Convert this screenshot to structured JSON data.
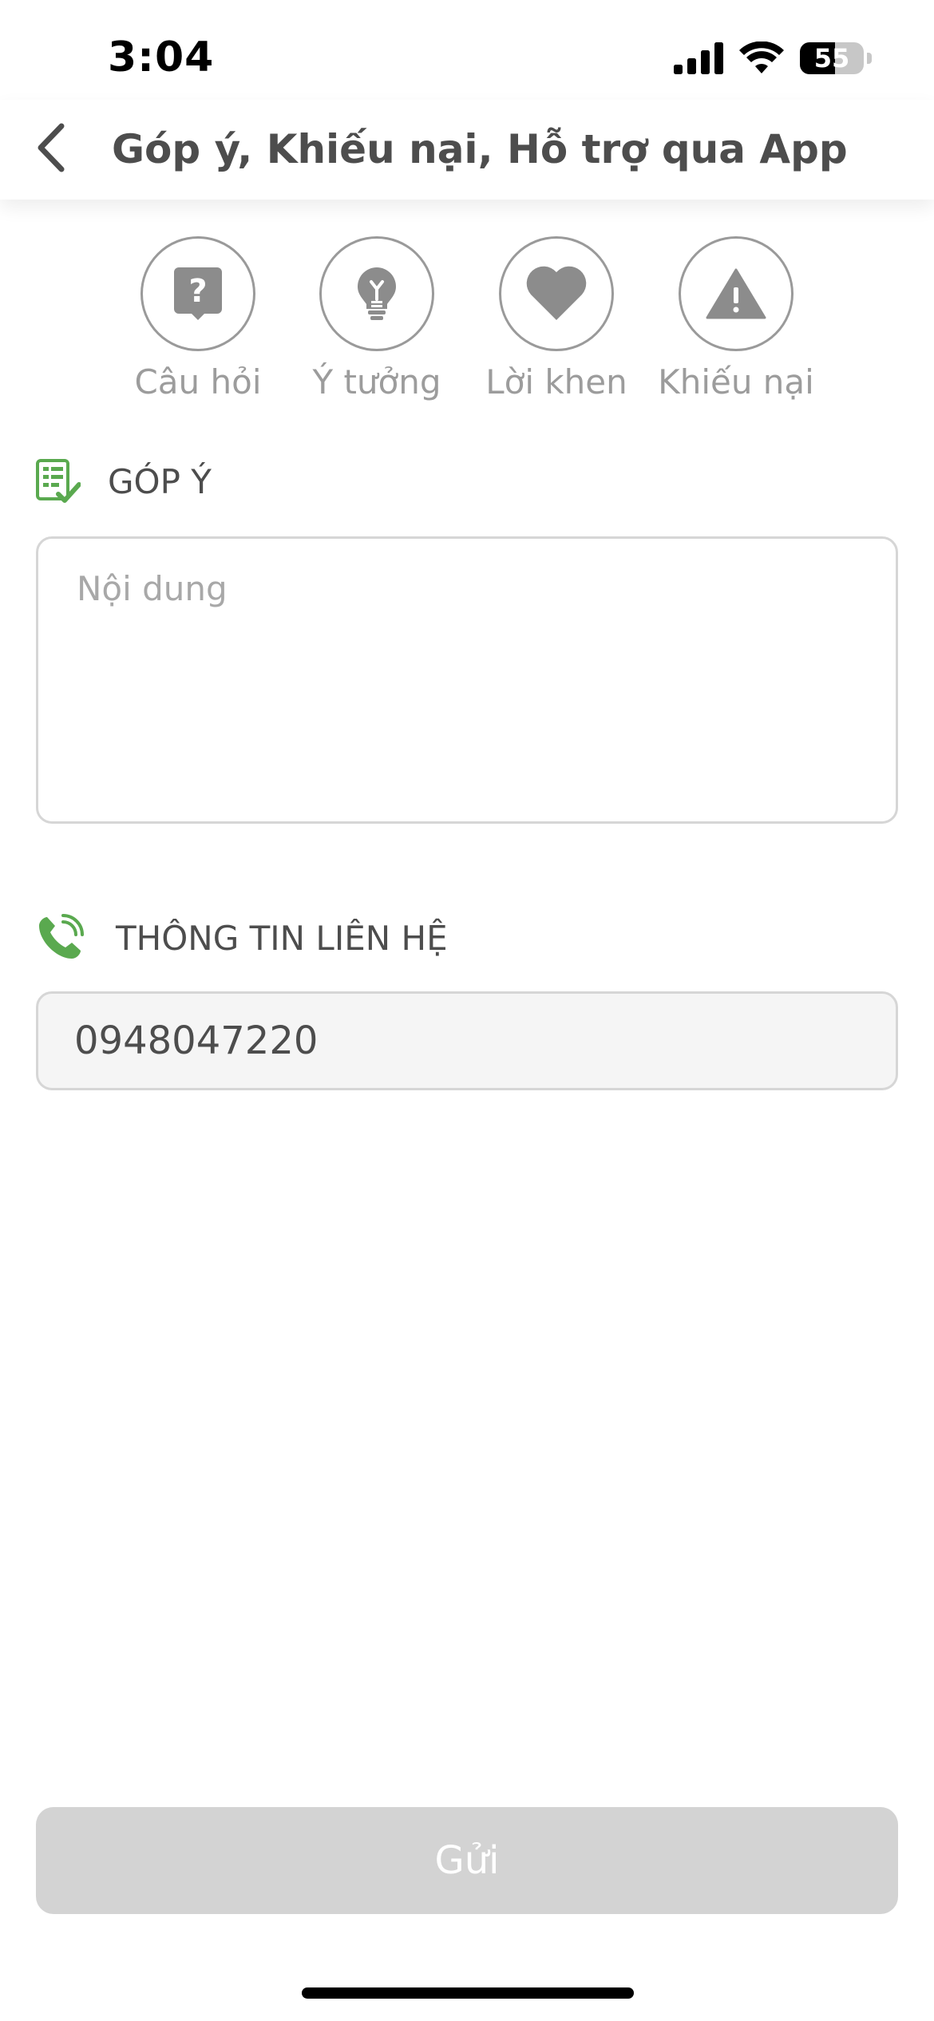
{
  "status_bar": {
    "time": "3:04",
    "battery_level": "55"
  },
  "header": {
    "title": "Góp ý, Khiếu nại, Hỗ trợ qua App",
    "back_icon": "chevron-left-icon"
  },
  "categories": [
    {
      "label": "Câu hỏi",
      "icon": "question-bubble-icon"
    },
    {
      "label": "Ý tưởng",
      "icon": "lightbulb-icon"
    },
    {
      "label": "Lời khen",
      "icon": "heart-icon"
    },
    {
      "label": "Khiếu nại",
      "icon": "warning-icon"
    }
  ],
  "feedback_section": {
    "title": "GÓP Ý",
    "icon": "checklist-icon",
    "content_placeholder": "Nội dung",
    "content_value": ""
  },
  "contact_section": {
    "title": "THÔNG TIN LIÊN HỆ",
    "icon": "phone-call-icon",
    "phone_value": "0948047220"
  },
  "submit": {
    "label": "Gửi"
  },
  "colors": {
    "accent_green": "#5aa94f",
    "icon_gray": "#8c8c8c",
    "button_disabled": "#d3d3d3"
  }
}
